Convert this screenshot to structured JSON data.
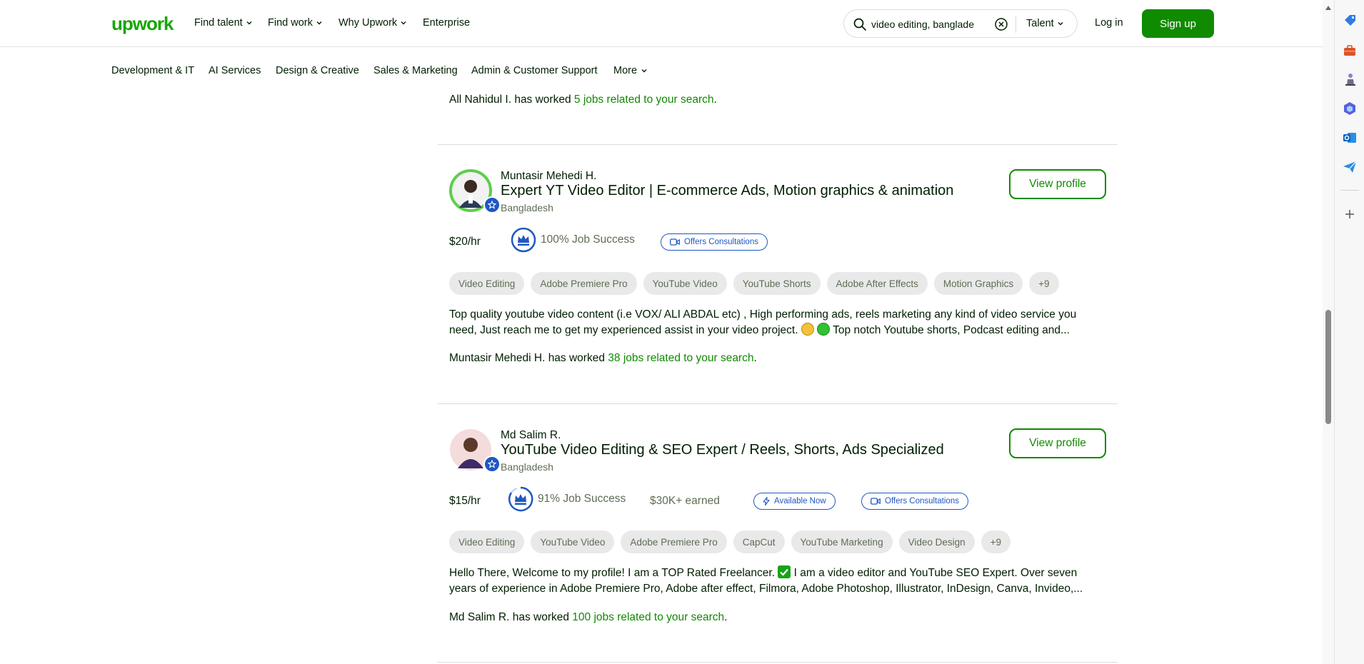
{
  "header": {
    "logo": "upwork",
    "nav": [
      "Find talent",
      "Find work",
      "Why Upwork",
      "Enterprise"
    ],
    "search_value": "video editing, banglades",
    "search_scope": "Talent",
    "login": "Log in",
    "signup": "Sign up"
  },
  "categories": [
    "Development & IT",
    "AI Services",
    "Design & Creative",
    "Sales & Marketing",
    "Admin & Customer Support",
    "More"
  ],
  "previous": {
    "worked_prefix": "All Nahidul I. has worked ",
    "worked_link": "5 jobs related to your search",
    "worked_suffix": "."
  },
  "freelancers": [
    {
      "name": "Muntasir Mehedi H.",
      "title": "Expert YT Video Editor | E-commerce Ads, Motion graphics & animation",
      "country": "Bangladesh",
      "view_label": "View profile",
      "rate": "$20/hr",
      "job_success": "100% Job Success",
      "consult": "Offers Consultations",
      "skills": [
        "Video Editing",
        "Adobe Premiere Pro",
        "YouTube Video",
        "YouTube Shorts",
        "Adobe After Effects",
        "Motion Graphics",
        "+9"
      ],
      "desc_line1": "Top quality youtube video content (i.e VOX/ ALI ABDAL etc) , High performing ads, reels marketing any kind of video service you",
      "desc_line2a": "need, Just reach me to get my experienced assist in your video project. ",
      "desc_line2b": " Top notch Youtube shorts, Podcast editing and...",
      "worked_prefix": "Muntasir Mehedi H. has worked ",
      "worked_link": "38 jobs related to your search",
      "worked_suffix": "."
    },
    {
      "name": "Md Salim R.",
      "title": "YouTube Video Editing & SEO Expert / Reels, Shorts, Ads Specialized",
      "country": "Bangladesh",
      "view_label": "View profile",
      "rate": "$15/hr",
      "job_success": "91% Job Success",
      "earned": "$30K+ earned",
      "available": "Available Now",
      "consult": "Offers Consultations",
      "skills": [
        "Video Editing",
        "YouTube Video",
        "Adobe Premiere Pro",
        "CapCut",
        "YouTube Marketing",
        "Video Design",
        "+9"
      ],
      "desc_line1a": "Hello There, Welcome to my profile! I am a TOP Rated Freelancer. ",
      "desc_line1b": " I am a video editor and YouTube SEO Expert. Over seven",
      "desc_line2": "years of experience in Adobe Premiere Pro, Adobe after effect, Filmora, Adobe Photoshop, Illustrator, InDesign, Canva, Invideo,...",
      "worked_prefix": "Md Salim R. has worked ",
      "worked_link": "100 jobs related to your search",
      "worked_suffix": "."
    }
  ],
  "colors": {
    "brand": "#14a800",
    "button": "#108a00",
    "badge": "#1f57c3"
  }
}
